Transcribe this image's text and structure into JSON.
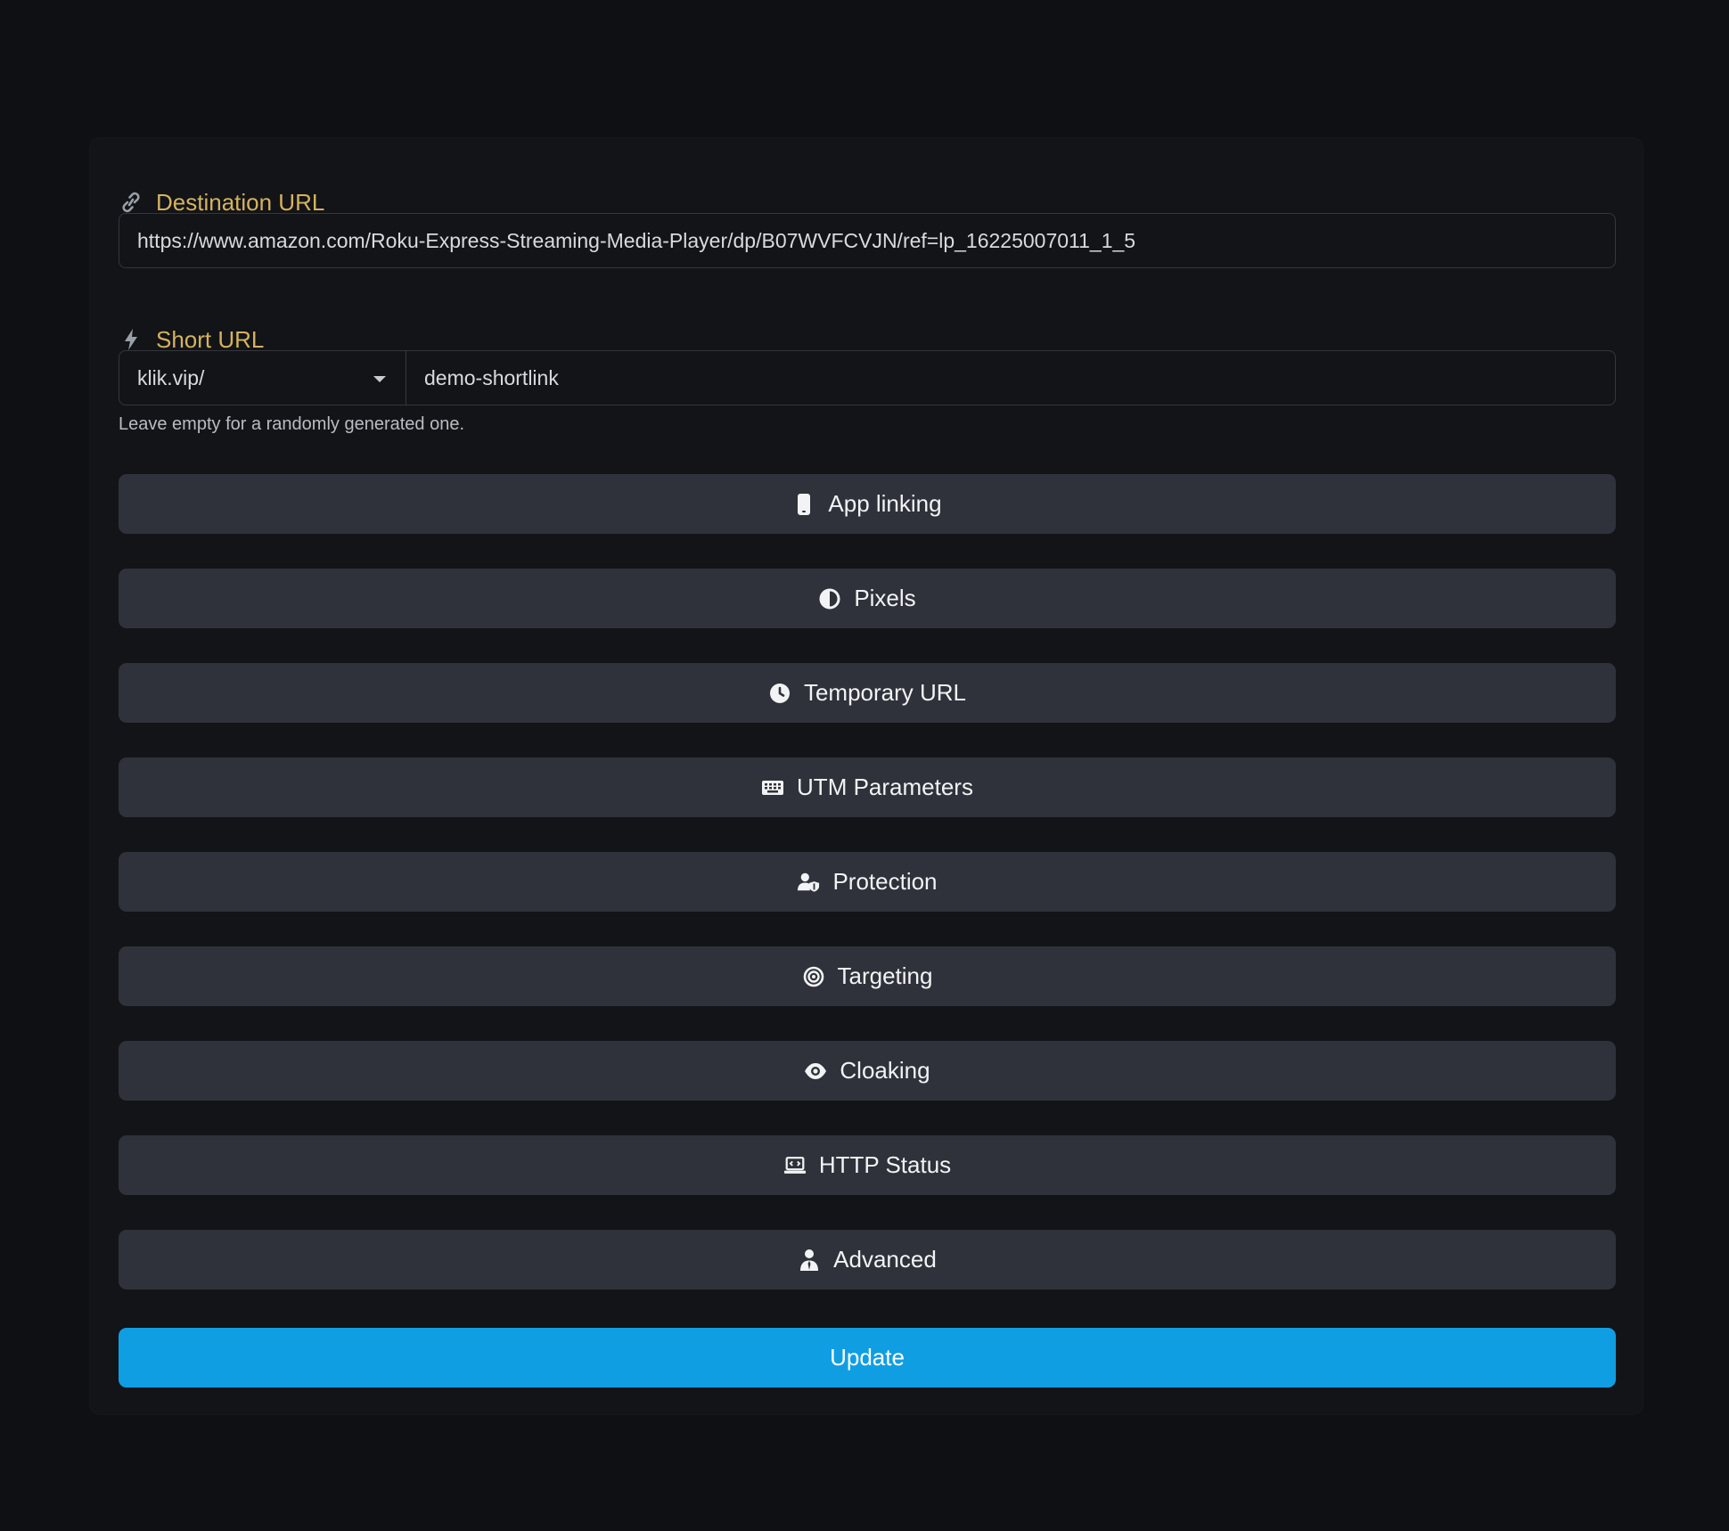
{
  "destination": {
    "label": "Destination URL",
    "icon": "link-icon",
    "value": "https://www.amazon.com/Roku-Express-Streaming-Media-Player/dp/B07WVFCVJN/ref=lp_16225007011_1_5"
  },
  "short_url": {
    "label": "Short URL",
    "icon": "bolt-icon",
    "domain": "klik.vip/",
    "slug": "demo-shortlink",
    "help": "Leave empty for a randomly generated one."
  },
  "options": [
    {
      "label": "App linking",
      "icon": "mobile-icon"
    },
    {
      "label": "Pixels",
      "icon": "adjust-icon"
    },
    {
      "label": "Temporary URL",
      "icon": "clock-icon"
    },
    {
      "label": "UTM Parameters",
      "icon": "keyboard-icon"
    },
    {
      "label": "Protection",
      "icon": "user-shield-icon"
    },
    {
      "label": "Targeting",
      "icon": "bullseye-icon"
    },
    {
      "label": "Cloaking",
      "icon": "eye-icon"
    },
    {
      "label": "HTTP Status",
      "icon": "laptop-code-icon"
    },
    {
      "label": "Advanced",
      "icon": "user-tie-icon"
    }
  ],
  "submit": {
    "label": "Update"
  },
  "colors": {
    "background": "#0e1013",
    "card": "#131417",
    "label_accent": "#d4b260",
    "option_button": "#2f323a",
    "primary": "#109ee3"
  }
}
